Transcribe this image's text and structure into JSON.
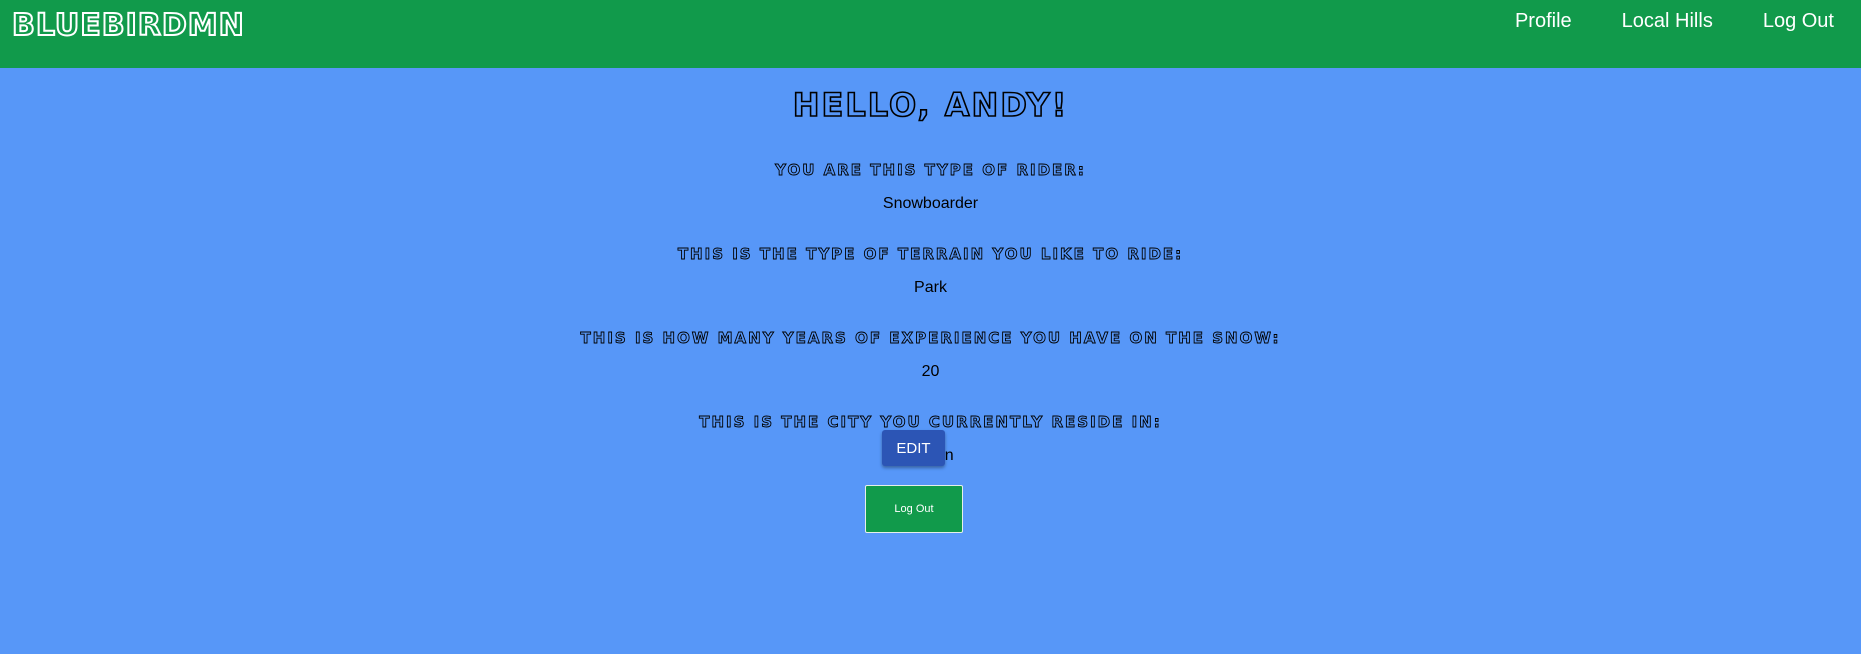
{
  "navbar": {
    "brand": "BlueBirdMN",
    "links": [
      "Profile",
      "Local Hills",
      "Log Out"
    ]
  },
  "profile": {
    "greeting": "Hello, Andy!",
    "rider_label": "You are this type of rider:",
    "rider_value": "Snowboarder",
    "terrain_label": "This is the type of terrain you like to ride:",
    "terrain_value": "Park",
    "experience_label": "This is how many years of experience you have on the snow:",
    "experience_value": "20",
    "city_label": "This is the city you currently reside in:",
    "city_value": "Eagan",
    "edit_label": "EDIT",
    "logout_label": "Log Out"
  },
  "colors": {
    "navbar_bg": "#119a4b",
    "page_bg": "#5797f8",
    "edit_button": "#2c55b5",
    "logout_button": "#119a4b"
  }
}
